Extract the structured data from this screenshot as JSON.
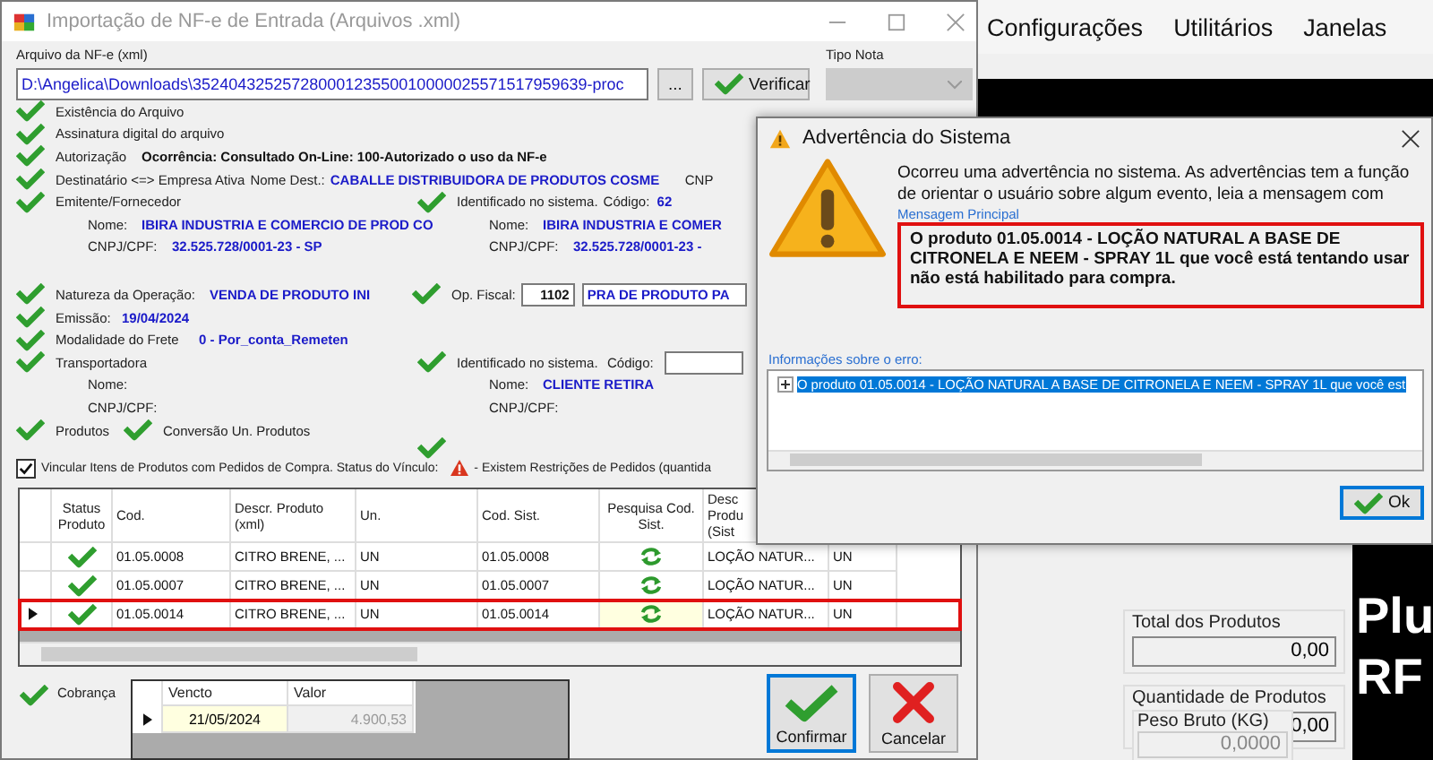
{
  "background_app": {
    "menu": [
      "Configurações",
      "Utilitários",
      "Janelas"
    ],
    "totals": [
      {
        "label": "Total dos Produtos",
        "value": "0,00"
      },
      {
        "label": "Quantidade de Produtos",
        "value": "0,00"
      }
    ],
    "peso": {
      "label": "Peso Bruto (KG)",
      "value": "0,0000"
    },
    "banner": [
      "Plu",
      "RF"
    ]
  },
  "main_window": {
    "title": "Importação de NF-e de Entrada (Arquivos .xml)",
    "file": {
      "label": "Arquivo da NF-e (xml)",
      "path": "D:\\Angelica\\Downloads\\35240432525728000123550010000025571517959639-proc",
      "browse": "...",
      "verify": "Verificar"
    },
    "tipo_nota": {
      "label": "Tipo Nota"
    },
    "checks": [
      "Existência do Arquivo",
      "Assinatura digital do arquivo"
    ],
    "autorizacao": {
      "label": "Autorização",
      "value": "Ocorrência: Consultado On-Line: 100-Autorizado o uso da NF-e"
    },
    "destinatario": {
      "label": "Destinatário <=> Empresa Ativa",
      "name_label": "Nome Dest.:",
      "name": "CABALLE DISTRIBUIDORA DE PRODUTOS COSME",
      "cnpj_label": "CNP"
    },
    "emitente": {
      "label": "Emitente/Fornecedor",
      "xml": {
        "name_label": "Nome:",
        "name": "IBIRA INDUSTRIA E COMERCIO DE PROD CO",
        "cnpj_label": "CNPJ/CPF:",
        "cnpj": "32.525.728/0001-23  -  SP"
      },
      "system": {
        "status": "Identificado no sistema.",
        "code_label": "Código:",
        "code": "62",
        "name_label": "Nome:",
        "name": "IBIRA INDUSTRIA E COMER",
        "cnpj_label": "CNPJ/CPF:",
        "cnpj": "32.525.728/0001-23  -"
      }
    },
    "natureza": {
      "label": "Natureza da Operação:",
      "value": "VENDA DE PRODUTO INI",
      "cfop_label": "Op. Fiscal:",
      "cfop": "1102",
      "cfop_desc": "PRA DE PRODUTO PA"
    },
    "emissao": {
      "label": "Emissão:",
      "value": "19/04/2024"
    },
    "frete": {
      "label": "Modalidade do Frete",
      "value": "0 - Por_conta_Remeten"
    },
    "transportadora": {
      "label": "Transportadora",
      "xml": {
        "name_label": "Nome:",
        "cnpj_label": "CNPJ/CPF:"
      },
      "system": {
        "status": "Identificado no sistema.",
        "code_label": "Código:",
        "name_label": "Nome:",
        "name": "CLIENTE RETIRA",
        "cnpj_label": "CNPJ/CPF:"
      }
    },
    "produtos": {
      "label": "Produtos",
      "conversion": "Conversão Un. Produtos"
    },
    "vinculo": {
      "checked": true,
      "label": "Vincular Itens de Produtos com Pedidos de Compra. Status do Vínculo:",
      "status": "- Existem Restrições de Pedidos (quantida"
    },
    "grid": {
      "columns": [
        "Status Produto",
        "Cod.",
        "Descr. Produto (xml)",
        "Un.",
        "Cod. Sist.",
        "Pesquisa Cod. Sist.",
        "Desc Produ (Sist"
      ],
      "rows": [
        {
          "cod": "01.05.0008",
          "descr": "CITRO BRENE, ...",
          "un": "UN",
          "cod_sist": "01.05.0008",
          "descr_sist": "LOÇÃO NATUR...",
          "column_8": "UN",
          "selected": false,
          "highlighted": false
        },
        {
          "cod": "01.05.0007",
          "descr": "CITRO BRENE, ...",
          "un": "UN",
          "cod_sist": "01.05.0007",
          "descr_sist": "LOÇÃO NATUR...",
          "column_8": "UN",
          "selected": false,
          "highlighted": false
        },
        {
          "cod": "01.05.0014",
          "descr": "CITRO BRENE, ...",
          "un": "UN",
          "cod_sist": "01.05.0014",
          "descr_sist": "LOÇÃO NATUR...",
          "column_8": "UN",
          "selected": true,
          "highlighted": true
        }
      ]
    },
    "cobranca": {
      "label": "Cobrança",
      "columns": [
        "Vencto",
        "Valor"
      ],
      "rows": [
        {
          "vencto": "21/05/2024",
          "valor": "4.900,53",
          "selected": true
        }
      ]
    },
    "buttons": [
      {
        "kind": "confirm",
        "label": "Confirmar"
      },
      {
        "kind": "cancel",
        "label": "Cancelar"
      }
    ]
  },
  "dialog": {
    "title": "Advertência do Sistema",
    "intro": "Ocorreu uma advertência no sistema. As advertências tem a função de orientar o usuário sobre algum evento, leia a mensagem com",
    "message_label": "Mensagem Principal",
    "message": "O produto 01.05.0014 - LOÇÃO NATURAL A BASE DE CITRONELA E NEEM - SPRAY 1L que você está tentando usar não está habilitado para compra.",
    "details_label": "Informações sobre o erro:",
    "details": [
      {
        "text": "O produto 01.05.0014 - LOÇÃO NATURAL A BASE DE CITRONELA E NEEM - SPRAY 1L que você est",
        "selected": true
      }
    ],
    "ok": "Ok"
  }
}
